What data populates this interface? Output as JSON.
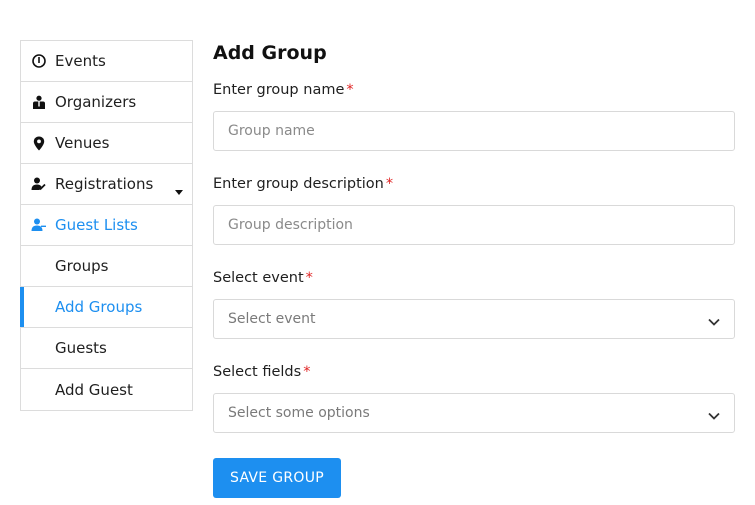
{
  "colors": {
    "accent": "#1d8ff0",
    "required": "#e02424",
    "border": "#dcdcdc"
  },
  "sidebar": {
    "items": [
      {
        "label": "Events",
        "icon": "info-circle-icon"
      },
      {
        "label": "Organizers",
        "icon": "organizer-icon"
      },
      {
        "label": "Venues",
        "icon": "map-pin-icon"
      },
      {
        "label": "Registrations",
        "icon": "user-register-icon"
      },
      {
        "label": "Guest Lists",
        "icon": "guest-list-icon"
      },
      {
        "label": "Groups"
      },
      {
        "label": "Add Groups"
      },
      {
        "label": "Guests"
      },
      {
        "label": "Add Guest"
      }
    ]
  },
  "form": {
    "title": "Add Group",
    "required_mark": "*",
    "group_name": {
      "label": "Enter group name",
      "placeholder": "Group name"
    },
    "group_description": {
      "label": "Enter group description",
      "placeholder": "Group description"
    },
    "event": {
      "label": "Select event",
      "placeholder": "Select event"
    },
    "fields": {
      "label": "Select fields",
      "placeholder": "Select some options"
    },
    "save_label": "SAVE GROUP"
  }
}
